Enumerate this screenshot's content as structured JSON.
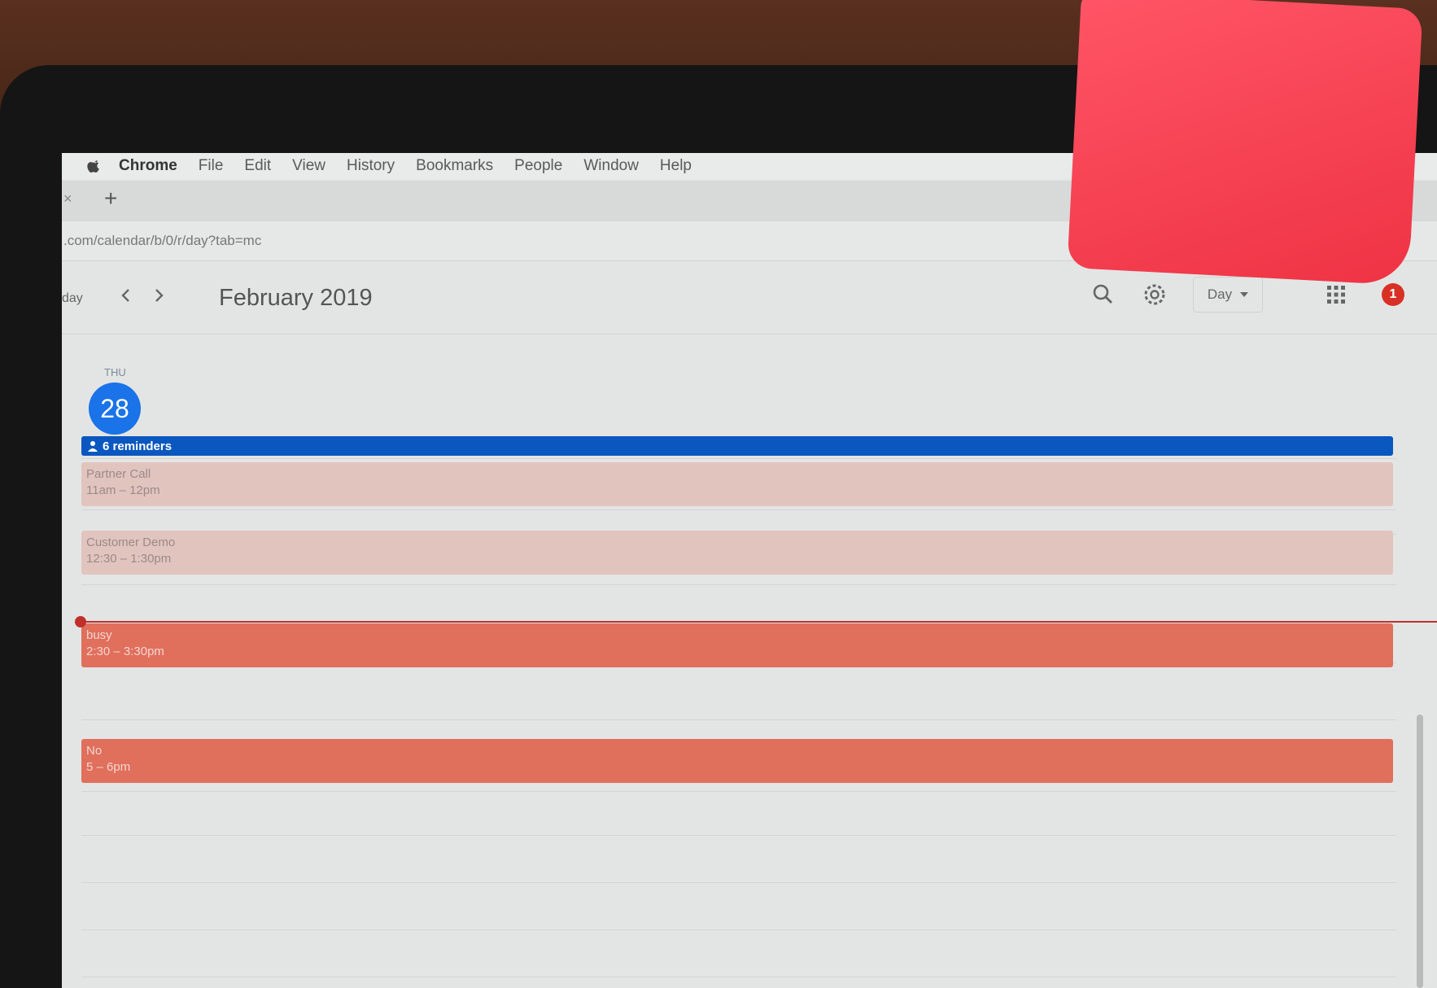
{
  "menubar": {
    "app_name": "Chrome",
    "items": [
      "File",
      "Edit",
      "View",
      "History",
      "Bookmarks",
      "People",
      "Window",
      "Help"
    ]
  },
  "tabs": {
    "close_glyph": "×",
    "new_tab_glyph": "+"
  },
  "address_bar": {
    "url": ".com/calendar/b/0/r/day?tab=mc"
  },
  "calendar": {
    "today_label": "day",
    "month_title": "February 2019",
    "view_label": "Day",
    "notifications_count": "1",
    "day_name": "THU",
    "day_number": "28",
    "reminders_label": "6 reminders",
    "events": [
      {
        "title": "Partner Call",
        "time": "11am – 12pm",
        "style": "light"
      },
      {
        "title": "Customer Demo",
        "time": "12:30 – 1:30pm",
        "style": "light"
      },
      {
        "title": "busy",
        "time": "2:30 – 3:30pm",
        "style": "strong"
      },
      {
        "title": "No",
        "time": "5 – 6pm",
        "style": "strong"
      }
    ]
  },
  "colors": {
    "accent_blue": "#1a73e8",
    "reminder_blue": "#0b57c0",
    "event_strong": "#e06f5c",
    "event_light": "#e2c4bf",
    "badge_red": "#d93025"
  },
  "icons": [
    "apple-icon",
    "chevron-left-icon",
    "chevron-right-icon",
    "search-icon",
    "gear-icon",
    "caret-down-icon",
    "apps-grid-icon",
    "person-icon"
  ]
}
